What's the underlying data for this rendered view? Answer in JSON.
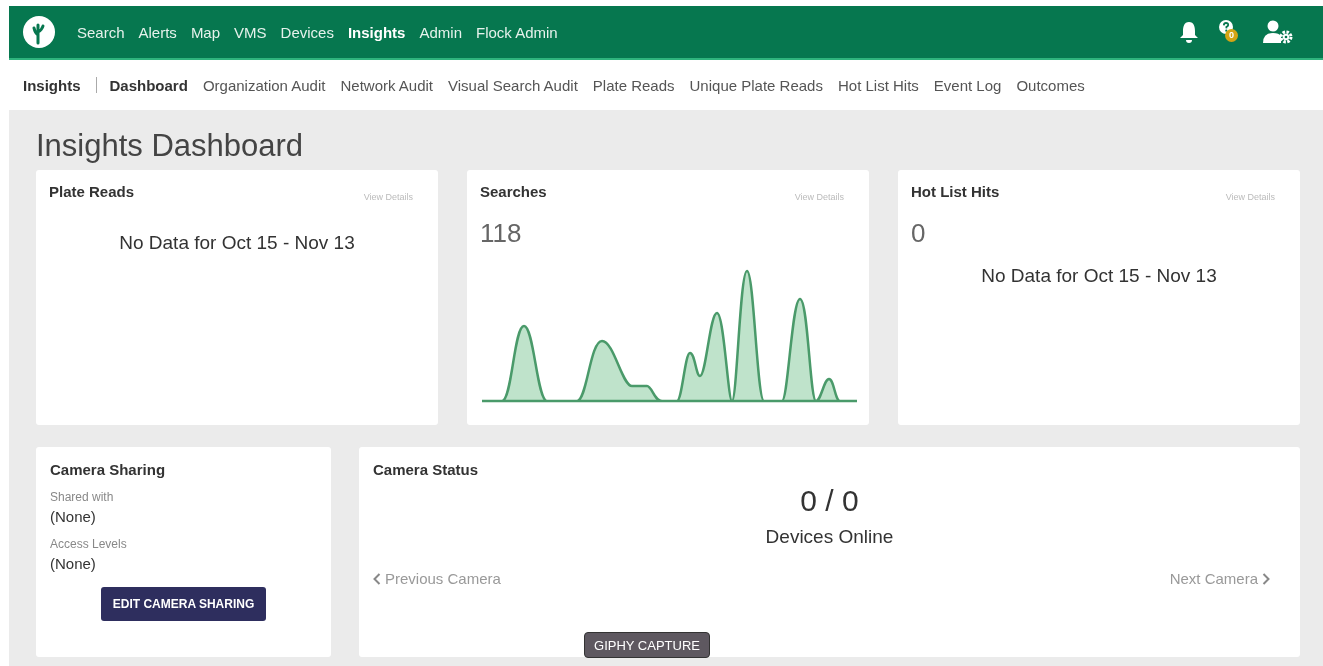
{
  "top_nav": {
    "items": [
      {
        "label": "Search",
        "selected": false
      },
      {
        "label": "Alerts",
        "selected": false
      },
      {
        "label": "Map",
        "selected": false
      },
      {
        "label": "VMS",
        "selected": false
      },
      {
        "label": "Devices",
        "selected": false
      },
      {
        "label": "Insights",
        "selected": true
      },
      {
        "label": "Admin",
        "selected": false
      },
      {
        "label": "Flock Admin",
        "selected": false
      }
    ],
    "help_badge": "0"
  },
  "sub_nav": {
    "section": "Insights",
    "items": [
      {
        "label": "Dashboard",
        "selected": true
      },
      {
        "label": "Organization Audit",
        "selected": false
      },
      {
        "label": "Network Audit",
        "selected": false
      },
      {
        "label": "Visual Search Audit",
        "selected": false
      },
      {
        "label": "Plate Reads",
        "selected": false
      },
      {
        "label": "Unique Plate Reads",
        "selected": false
      },
      {
        "label": "Hot List Hits",
        "selected": false
      },
      {
        "label": "Event Log",
        "selected": false
      },
      {
        "label": "Outcomes",
        "selected": false
      }
    ]
  },
  "page_title": "Insights Dashboard",
  "metric_cards": [
    {
      "title": "Plate Reads",
      "link": "View Details",
      "no_data": "No Data for Oct 15 - Nov 13"
    },
    {
      "title": "Searches",
      "link": "View Details",
      "count": "118",
      "kind": "chart"
    },
    {
      "title": "Hot List Hits",
      "link": "View Details",
      "count": "0",
      "no_data": "No Data for Oct 15 - Nov 13"
    }
  ],
  "camera_sharing": {
    "title": "Camera Sharing",
    "fields": [
      {
        "label": "Shared with",
        "value": "(None)"
      },
      {
        "label": "Access Levels",
        "value": "(None)"
      }
    ],
    "button": "EDIT CAMERA SHARING"
  },
  "camera_status": {
    "title": "Camera Status",
    "count": "0 / 0",
    "caption": "Devices Online",
    "previous": "Previous Camera",
    "next": "Next Camera"
  },
  "tooltip": "GIPHY CAPTURE"
}
